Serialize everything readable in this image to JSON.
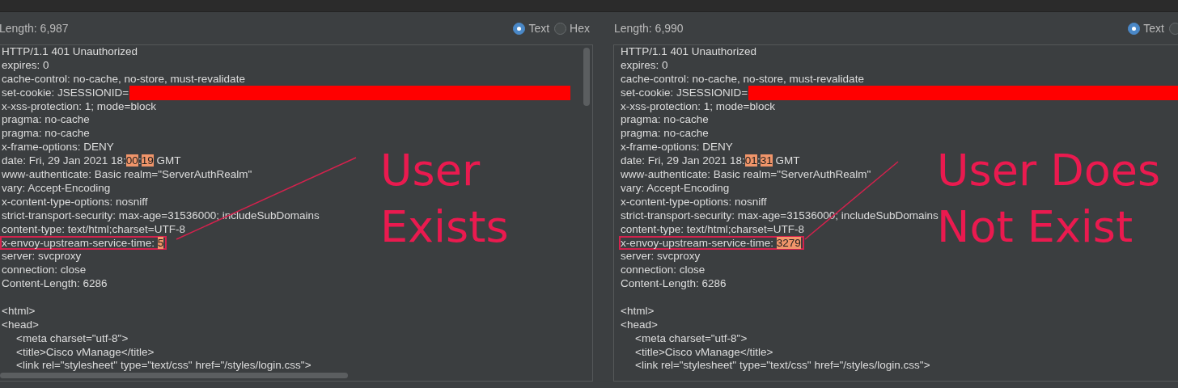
{
  "panes": [
    {
      "length": "Length: 6,987",
      "radios": [
        {
          "label": "Text",
          "selected": true
        },
        {
          "label": "Hex",
          "selected": false
        }
      ],
      "headers": [
        {
          "text": "HTTP/1.1 401 Unauthorized"
        },
        {
          "text": "expires: 0"
        },
        {
          "text": "cache-control: no-cache, no-store, must-revalidate"
        },
        {
          "text": "set-cookie: JSESSIONID=",
          "redacted": true
        },
        {
          "text": "x-xss-protection: 1; mode=block"
        },
        {
          "text": "pragma: no-cache"
        },
        {
          "text": "pragma: no-cache"
        },
        {
          "text": "x-frame-options: DENY"
        },
        {
          "parts": [
            {
              "text": "date: Fri, 29 Jan 2021 18:",
              "changed": false
            },
            {
              "text": "00",
              "changed": true
            },
            {
              "text": ":",
              "changed": false
            },
            {
              "text": "19",
              "changed": true
            },
            {
              "text": " GMT",
              "changed": false
            }
          ]
        },
        {
          "text": "www-authenticate: Basic realm=\"ServerAuthRealm\""
        },
        {
          "text": "vary: Accept-Encoding"
        },
        {
          "text": "x-content-type-options: nosniff"
        },
        {
          "text": "strict-transport-security: max-age=31536000; includeSubDomains"
        },
        {
          "text": "content-type: text/html;charset=UTF-8"
        },
        {
          "parts": [
            {
              "text": "x-envoy-upstream-service-time: ",
              "changed": false
            },
            {
              "text": "5",
              "changed": true
            }
          ],
          "boxed": true
        },
        {
          "text": "server: svcproxy"
        },
        {
          "text": "connection: close"
        },
        {
          "text": "Content-Length: 6286"
        }
      ],
      "body": [
        {
          "text": "<html>"
        },
        {
          "text": "<head>",
          "children": [
            {
              "text": "<meta charset=\"utf-8\">"
            },
            {
              "text": "<title>Cisco vManage</title>"
            },
            {
              "text": "<link rel=\"stylesheet\" type=\"text/css\" href=\"/styles/login.css\">"
            }
          ]
        }
      ],
      "annotation": [
        "User",
        "Exists"
      ]
    },
    {
      "length": "Length: 6,990",
      "radios": [
        {
          "label": "Text",
          "selected": true
        },
        {
          "selected": false
        }
      ],
      "headers": [
        {
          "text": "HTTP/1.1 401 Unauthorized"
        },
        {
          "text": "expires: 0"
        },
        {
          "text": "cache-control: no-cache, no-store, must-revalidate"
        },
        {
          "text": "set-cookie: JSESSIONID=",
          "redacted": true
        },
        {
          "text": "x-xss-protection: 1; mode=block"
        },
        {
          "text": "pragma: no-cache"
        },
        {
          "text": "pragma: no-cache"
        },
        {
          "text": "x-frame-options: DENY"
        },
        {
          "parts": [
            {
              "text": "date: Fri, 29 Jan 2021 18:",
              "changed": false
            },
            {
              "text": "01",
              "changed": true
            },
            {
              "text": ":",
              "changed": false
            },
            {
              "text": "31",
              "changed": true
            },
            {
              "text": " GMT",
              "changed": false
            }
          ]
        },
        {
          "text": "www-authenticate: Basic realm=\"ServerAuthRealm\""
        },
        {
          "text": "vary: Accept-Encoding"
        },
        {
          "text": "x-content-type-options: nosniff"
        },
        {
          "text": "strict-transport-security: max-age=31536000; includeSubDomains"
        },
        {
          "text": "content-type: text/html;charset=UTF-8"
        },
        {
          "parts": [
            {
              "text": "x-envoy-upstream-service-time: ",
              "changed": false
            },
            {
              "text": "3279",
              "changed": true
            }
          ],
          "boxed": true
        },
        {
          "text": "server: svcproxy"
        },
        {
          "text": "connection: close"
        },
        {
          "text": "Content-Length: 6286"
        }
      ],
      "body": [
        {
          "text": "<html>"
        },
        {
          "text": "<head>",
          "children": [
            {
              "text": "<meta charset=\"utf-8\">"
            },
            {
              "text": "<title>Cisco vManage</title>"
            },
            {
              "text": "<link rel=\"stylesheet\" type=\"text/css\" href=\"/styles/login.css\">"
            }
          ]
        }
      ],
      "annotation": [
        "User Does",
        "Not Exist"
      ]
    }
  ]
}
